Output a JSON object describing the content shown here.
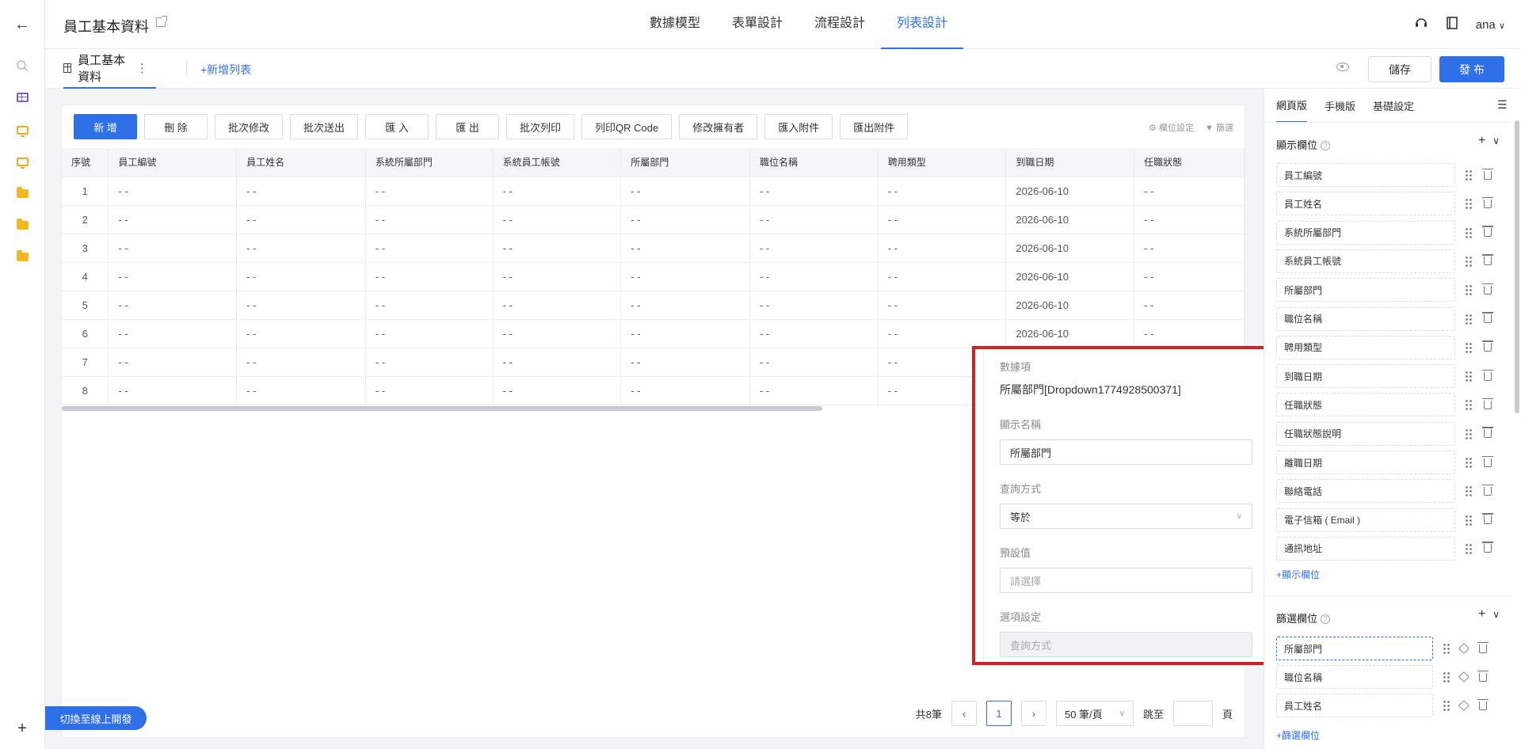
{
  "header": {
    "app_title": "員工基本資料",
    "tabs": [
      "數據模型",
      "表單設計",
      "流程設計",
      "列表設計"
    ],
    "active_tab": 3,
    "user": "ana"
  },
  "subbar": {
    "list_tab": "員工基本資料",
    "add_list": "+新增列表",
    "save": "儲存",
    "publish": "發 布"
  },
  "toolbar": {
    "buttons": [
      "新 增",
      "刪 除",
      "批次修改",
      "批次送出",
      "匯 入",
      "匯 出",
      "批次列印",
      "列印QR Code",
      "修改擁有者",
      "匯入附件",
      "匯出附件"
    ],
    "column_settings": "欄位設定",
    "filter": "篩選"
  },
  "table": {
    "columns": [
      "序號",
      "員工編號",
      "員工姓名",
      "系統所屬部門",
      "系統員工帳號",
      "所屬部門",
      "職位名稱",
      "聘用類型",
      "到職日期",
      "任職狀態"
    ],
    "rows": [
      [
        "1",
        "- -",
        "- -",
        "- -",
        "- -",
        "- -",
        "- -",
        "- -",
        "2026-06-10",
        "- -"
      ],
      [
        "2",
        "- -",
        "- -",
        "- -",
        "- -",
        "- -",
        "- -",
        "- -",
        "2026-06-10",
        "- -"
      ],
      [
        "3",
        "- -",
        "- -",
        "- -",
        "- -",
        "- -",
        "- -",
        "- -",
        "2026-06-10",
        "- -"
      ],
      [
        "4",
        "- -",
        "- -",
        "- -",
        "- -",
        "- -",
        "- -",
        "- -",
        "2026-06-10",
        "- -"
      ],
      [
        "5",
        "- -",
        "- -",
        "- -",
        "- -",
        "- -",
        "- -",
        "- -",
        "2026-06-10",
        "- -"
      ],
      [
        "6",
        "- -",
        "- -",
        "- -",
        "- -",
        "- -",
        "- -",
        "- -",
        "2026-06-10",
        "- -"
      ],
      [
        "7",
        "- -",
        "- -",
        "- -",
        "- -",
        "- -",
        "- -",
        "- -",
        "",
        ""
      ],
      [
        "8",
        "- -",
        "- -",
        "- -",
        "- -",
        "- -",
        "- -",
        "- -",
        "",
        ""
      ]
    ]
  },
  "pager": {
    "total": "共8筆",
    "current_page": "1",
    "page_size": "50 筆/頁",
    "jump_label": "跳至",
    "page_unit": "頁"
  },
  "switch_button": "切換至線上開發",
  "popover": {
    "data_item_label": "數據項",
    "data_item_value": "所屬部門[Dropdown1774928500371]",
    "display_name_label": "顯示名稱",
    "display_name_value": "所屬部門",
    "query_mode_label": "查詢方式",
    "query_mode_value": "等於",
    "default_label": "預設值",
    "default_placeholder": "請選擇",
    "options_label": "選項設定",
    "options_value": "查詢方式"
  },
  "right_panel": {
    "tabs": [
      "網頁版",
      "手機版",
      "基礎設定"
    ],
    "display_section": "顯示欄位",
    "display_fields": [
      "員工編號",
      "員工姓名",
      "系統所屬部門",
      "系統員工帳號",
      "所屬部門",
      "職位名稱",
      "聘用類型",
      "到職日期",
      "任職狀態",
      "任職狀態說明",
      "離職日期",
      "聯絡電話",
      "電子信箱 ( Email )",
      "通訊地址"
    ],
    "add_display": "+顯示欄位",
    "filter_section": "篩選欄位",
    "filter_fields": [
      "所屬部門",
      "職位名稱",
      "員工姓名"
    ],
    "add_filter": "+篩選欄位"
  },
  "colors": {
    "accent": "#2f6fe8",
    "highlight_border": "#d42222"
  }
}
